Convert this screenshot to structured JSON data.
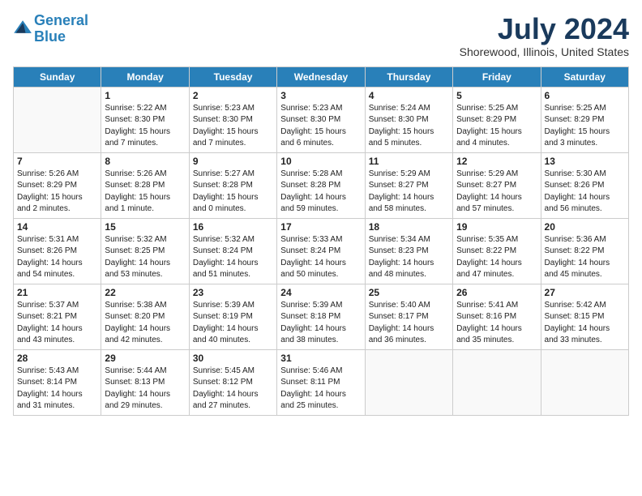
{
  "header": {
    "logo_line1": "General",
    "logo_line2": "Blue",
    "month_year": "July 2024",
    "location": "Shorewood, Illinois, United States"
  },
  "weekdays": [
    "Sunday",
    "Monday",
    "Tuesday",
    "Wednesday",
    "Thursday",
    "Friday",
    "Saturday"
  ],
  "weeks": [
    [
      {
        "day": "",
        "info": ""
      },
      {
        "day": "1",
        "info": "Sunrise: 5:22 AM\nSunset: 8:30 PM\nDaylight: 15 hours\nand 7 minutes."
      },
      {
        "day": "2",
        "info": "Sunrise: 5:23 AM\nSunset: 8:30 PM\nDaylight: 15 hours\nand 7 minutes."
      },
      {
        "day": "3",
        "info": "Sunrise: 5:23 AM\nSunset: 8:30 PM\nDaylight: 15 hours\nand 6 minutes."
      },
      {
        "day": "4",
        "info": "Sunrise: 5:24 AM\nSunset: 8:30 PM\nDaylight: 15 hours\nand 5 minutes."
      },
      {
        "day": "5",
        "info": "Sunrise: 5:25 AM\nSunset: 8:29 PM\nDaylight: 15 hours\nand 4 minutes."
      },
      {
        "day": "6",
        "info": "Sunrise: 5:25 AM\nSunset: 8:29 PM\nDaylight: 15 hours\nand 3 minutes."
      }
    ],
    [
      {
        "day": "7",
        "info": "Sunrise: 5:26 AM\nSunset: 8:29 PM\nDaylight: 15 hours\nand 2 minutes."
      },
      {
        "day": "8",
        "info": "Sunrise: 5:26 AM\nSunset: 8:28 PM\nDaylight: 15 hours\nand 1 minute."
      },
      {
        "day": "9",
        "info": "Sunrise: 5:27 AM\nSunset: 8:28 PM\nDaylight: 15 hours\nand 0 minutes."
      },
      {
        "day": "10",
        "info": "Sunrise: 5:28 AM\nSunset: 8:28 PM\nDaylight: 14 hours\nand 59 minutes."
      },
      {
        "day": "11",
        "info": "Sunrise: 5:29 AM\nSunset: 8:27 PM\nDaylight: 14 hours\nand 58 minutes."
      },
      {
        "day": "12",
        "info": "Sunrise: 5:29 AM\nSunset: 8:27 PM\nDaylight: 14 hours\nand 57 minutes."
      },
      {
        "day": "13",
        "info": "Sunrise: 5:30 AM\nSunset: 8:26 PM\nDaylight: 14 hours\nand 56 minutes."
      }
    ],
    [
      {
        "day": "14",
        "info": "Sunrise: 5:31 AM\nSunset: 8:26 PM\nDaylight: 14 hours\nand 54 minutes."
      },
      {
        "day": "15",
        "info": "Sunrise: 5:32 AM\nSunset: 8:25 PM\nDaylight: 14 hours\nand 53 minutes."
      },
      {
        "day": "16",
        "info": "Sunrise: 5:32 AM\nSunset: 8:24 PM\nDaylight: 14 hours\nand 51 minutes."
      },
      {
        "day": "17",
        "info": "Sunrise: 5:33 AM\nSunset: 8:24 PM\nDaylight: 14 hours\nand 50 minutes."
      },
      {
        "day": "18",
        "info": "Sunrise: 5:34 AM\nSunset: 8:23 PM\nDaylight: 14 hours\nand 48 minutes."
      },
      {
        "day": "19",
        "info": "Sunrise: 5:35 AM\nSunset: 8:22 PM\nDaylight: 14 hours\nand 47 minutes."
      },
      {
        "day": "20",
        "info": "Sunrise: 5:36 AM\nSunset: 8:22 PM\nDaylight: 14 hours\nand 45 minutes."
      }
    ],
    [
      {
        "day": "21",
        "info": "Sunrise: 5:37 AM\nSunset: 8:21 PM\nDaylight: 14 hours\nand 43 minutes."
      },
      {
        "day": "22",
        "info": "Sunrise: 5:38 AM\nSunset: 8:20 PM\nDaylight: 14 hours\nand 42 minutes."
      },
      {
        "day": "23",
        "info": "Sunrise: 5:39 AM\nSunset: 8:19 PM\nDaylight: 14 hours\nand 40 minutes."
      },
      {
        "day": "24",
        "info": "Sunrise: 5:39 AM\nSunset: 8:18 PM\nDaylight: 14 hours\nand 38 minutes."
      },
      {
        "day": "25",
        "info": "Sunrise: 5:40 AM\nSunset: 8:17 PM\nDaylight: 14 hours\nand 36 minutes."
      },
      {
        "day": "26",
        "info": "Sunrise: 5:41 AM\nSunset: 8:16 PM\nDaylight: 14 hours\nand 35 minutes."
      },
      {
        "day": "27",
        "info": "Sunrise: 5:42 AM\nSunset: 8:15 PM\nDaylight: 14 hours\nand 33 minutes."
      }
    ],
    [
      {
        "day": "28",
        "info": "Sunrise: 5:43 AM\nSunset: 8:14 PM\nDaylight: 14 hours\nand 31 minutes."
      },
      {
        "day": "29",
        "info": "Sunrise: 5:44 AM\nSunset: 8:13 PM\nDaylight: 14 hours\nand 29 minutes."
      },
      {
        "day": "30",
        "info": "Sunrise: 5:45 AM\nSunset: 8:12 PM\nDaylight: 14 hours\nand 27 minutes."
      },
      {
        "day": "31",
        "info": "Sunrise: 5:46 AM\nSunset: 8:11 PM\nDaylight: 14 hours\nand 25 minutes."
      },
      {
        "day": "",
        "info": ""
      },
      {
        "day": "",
        "info": ""
      },
      {
        "day": "",
        "info": ""
      }
    ]
  ]
}
